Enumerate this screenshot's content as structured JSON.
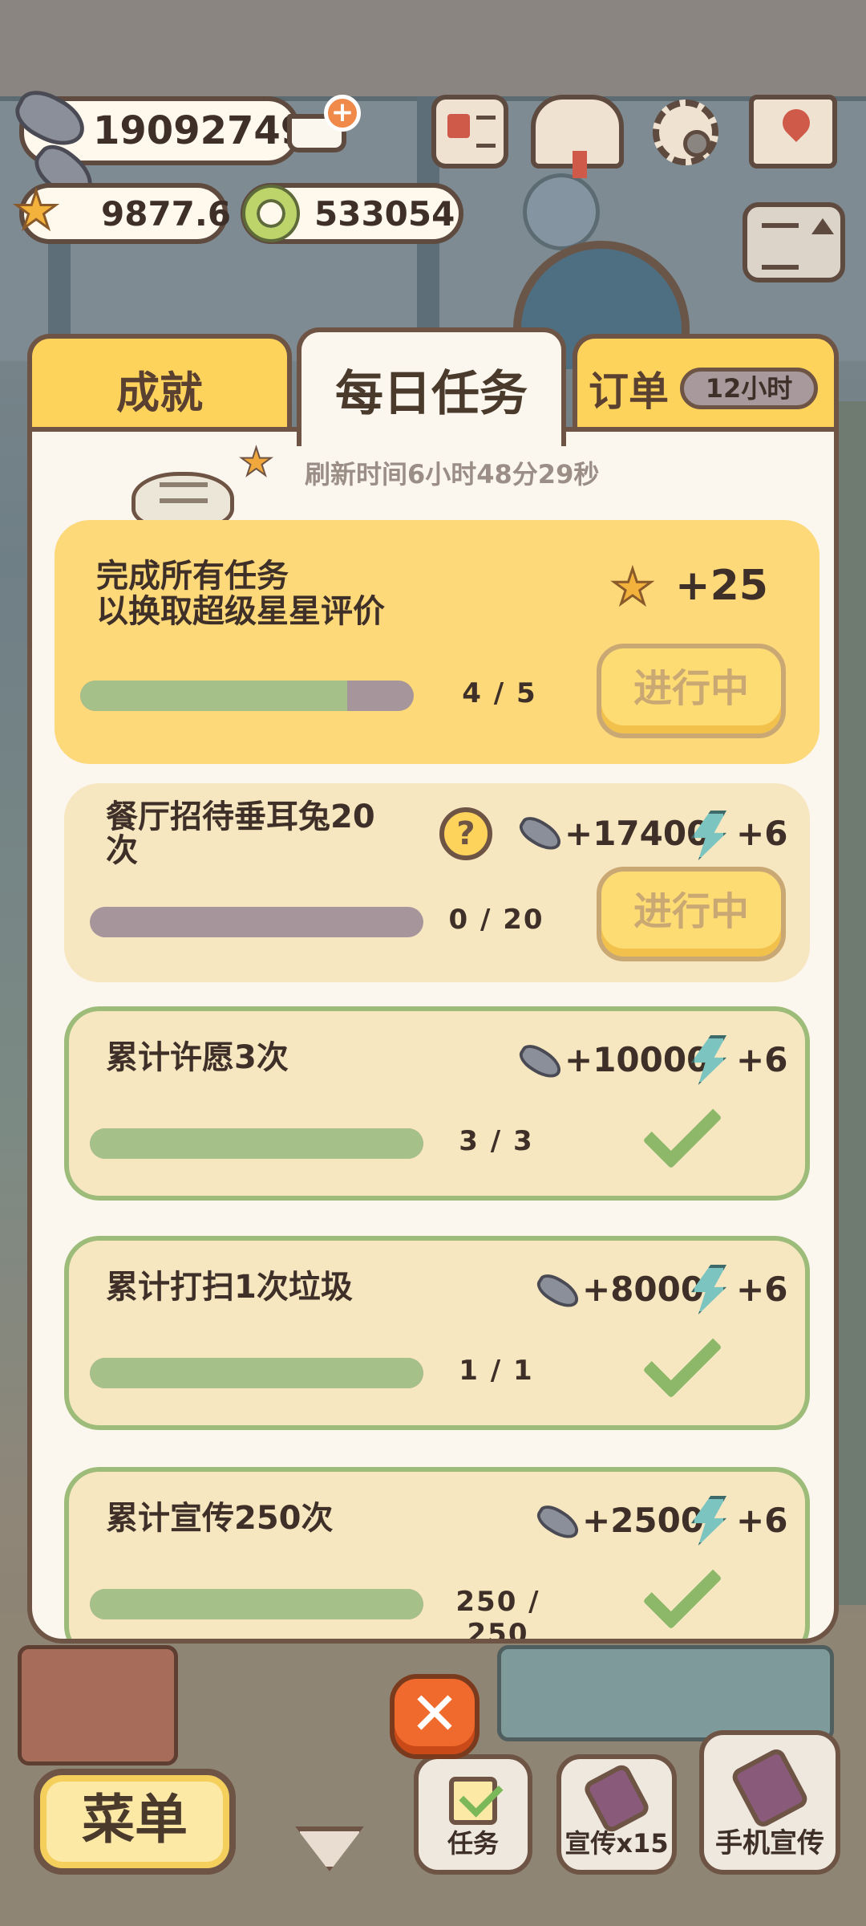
{
  "hud": {
    "fish_count": "19092749",
    "star_rating": "9877.6",
    "ring_count": "533054"
  },
  "tabs": {
    "achievements": "成就",
    "daily": "每日任务",
    "orders": "订单",
    "orders_badge": "12小时"
  },
  "refresh_text": "刷新时间6小时48分29秒",
  "summary": {
    "title_line1": "完成所有任务",
    "title_line2": "以换取超级星星评价",
    "reward": "+25",
    "progress": "4 / 5",
    "progress_fraction": 0.8,
    "status": "进行中"
  },
  "tasks": [
    {
      "title_line1": "餐厅招待垂耳兔20",
      "title_line2": "次",
      "fish": "+17400",
      "energy": "+6",
      "progress": "0 / 20",
      "fraction": 0,
      "status": "进行中",
      "done": false
    },
    {
      "title_line1": "累计许愿3次",
      "fish": "+10000",
      "energy": "+6",
      "progress": "3 / 3",
      "fraction": 1,
      "done": true
    },
    {
      "title_line1": "累计打扫1次垃圾",
      "fish": "+8000",
      "energy": "+6",
      "progress": "1 / 1",
      "fraction": 1,
      "done": true
    },
    {
      "title_line1": "累计宣传250次",
      "fish": "+2500",
      "energy": "+6",
      "progress": "250 / 250",
      "fraction": 1,
      "done": true
    }
  ],
  "bottom": {
    "menu": "菜单",
    "task": "任务",
    "promo": "宣传x15",
    "phone_promo": "手机宣传"
  },
  "icons": [
    "fish-icon",
    "cart-plus-icon",
    "star-icon",
    "ring-icon",
    "newspaper-icon",
    "recipe-book-icon",
    "gear-icon",
    "map-icon",
    "sort-icon",
    "close-icon",
    "check-icon",
    "energy-icon",
    "question-icon",
    "down-arrow-icon"
  ],
  "colors": {
    "tab_active": "#fbf6ee",
    "tab_inactive": "#fdd35c",
    "progress_fill": "#a6c08a",
    "close_button": "#ef6a2c"
  }
}
